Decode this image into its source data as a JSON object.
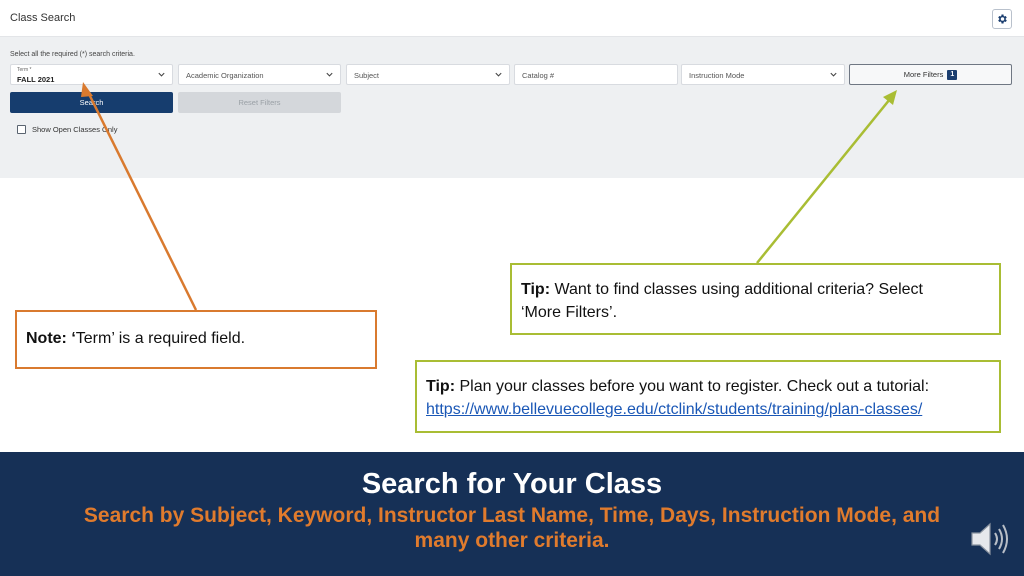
{
  "header": {
    "title": "Class Search"
  },
  "search": {
    "instructions": "Select all the required (*) search criteria.",
    "term_label": "Term *",
    "term_value": "FALL 2021",
    "academic_org_placeholder": "Academic Organization",
    "subject_placeholder": "Subject",
    "catalog_placeholder": "Catalog #",
    "instruction_mode_placeholder": "Instruction Mode",
    "more_filters_label": "More Filters",
    "more_filters_count": "1",
    "search_button": "Search",
    "reset_button": "Reset Filters",
    "open_classes_label": "Show Open Classes Only"
  },
  "annotations": {
    "note_bold": "Note: ‘",
    "note_text": "Term’ is a required field.",
    "tip1_bold": "Tip:",
    "tip1_line1": " Want to find classes using additional criteria? Select",
    "tip1_line2": "‘More Filters’.",
    "tip2_bold": "Tip:",
    "tip2_line1": " Plan your classes before you want to register. Check out a tutorial:",
    "tip2_link": "https://www.bellevuecollege.edu/ctclink/students/training/plan-classes/"
  },
  "banner": {
    "title": "Search for Your Class",
    "subtitle": "Search by Subject, Keyword, Instructor Last Name, Time, Days, Instruction Mode, and many other criteria."
  },
  "colors": {
    "banner_bg": "#163056",
    "banner_subtitle": "#e07b2d",
    "note_border": "#d97a2f",
    "tip_border": "#a9bd34",
    "primary_button": "#163d6e"
  },
  "icons": {
    "settings": "gear-icon",
    "dropdown": "chevron-down-icon",
    "audio": "speaker-icon"
  }
}
